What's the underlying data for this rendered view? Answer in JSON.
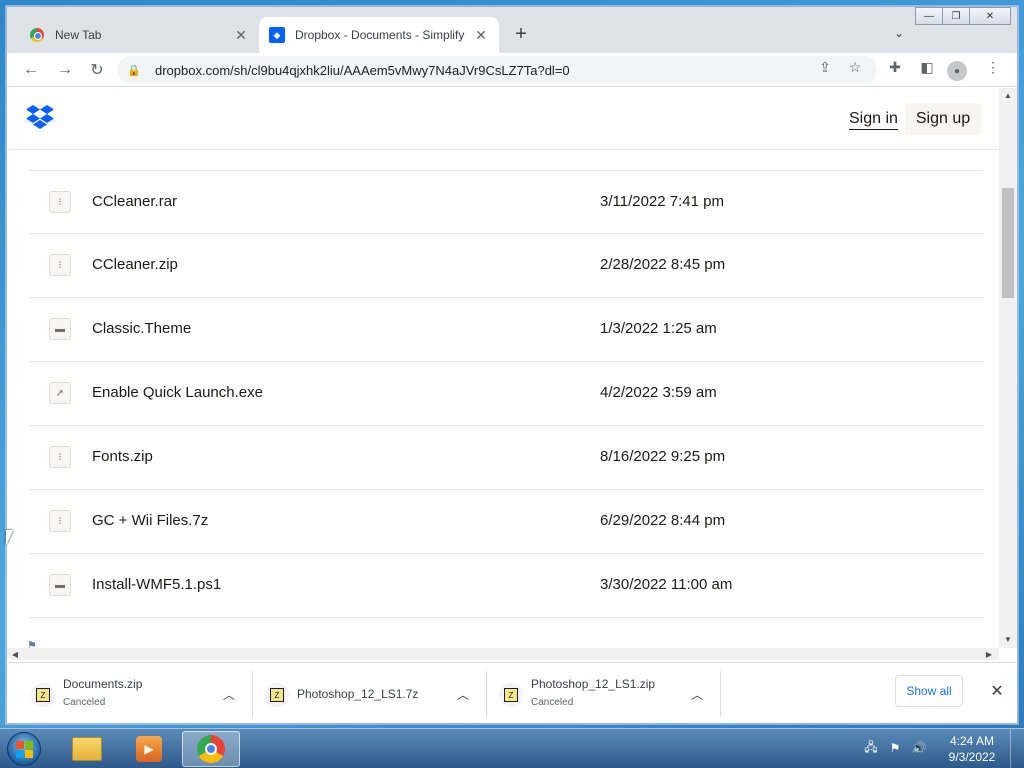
{
  "browser": {
    "tabs": [
      {
        "title": "New Tab",
        "favicon": "chrome-icon",
        "active": false
      },
      {
        "title": "Dropbox - Documents - Simplify",
        "favicon": "dropbox-icon",
        "active": true
      }
    ],
    "url": "dropbox.com/sh/cl9bu4qjxhk2liu/AAAem5vMwy7N4aJVr9CsLZ7Ta?dl=0",
    "window_controls": {
      "minimize": "—",
      "restore": "❐",
      "close": "✕"
    }
  },
  "header": {
    "signin_label": "Sign in",
    "signup_label": "Sign up"
  },
  "files": [
    {
      "name": "CCleaner.rar",
      "date": "3/11/2022 7:41 pm",
      "icon": "⁝"
    },
    {
      "name": "CCleaner.zip",
      "date": "2/28/2022 8:45 pm",
      "icon": "⁝"
    },
    {
      "name": "Classic.Theme",
      "date": "1/3/2022 1:25 am",
      "icon": "▬"
    },
    {
      "name": "Enable Quick Launch.exe",
      "date": "4/2/2022 3:59 am",
      "icon": "➚"
    },
    {
      "name": "Fonts.zip",
      "date": "8/16/2022 9:25 pm",
      "icon": "⁝"
    },
    {
      "name": "GC + Wii Files.7z",
      "date": "6/29/2022 8:44 pm",
      "icon": "⁝"
    },
    {
      "name": "Install-WMF5.1.ps1",
      "date": "3/30/2022 11:00 am",
      "icon": "▬"
    }
  ],
  "downloads": {
    "items": [
      {
        "name": "Documents.zip",
        "status": "Canceled"
      },
      {
        "name": "Photoshop_12_LS1.7z",
        "status": ""
      },
      {
        "name": "Photoshop_12_LS1.zip",
        "status": "Canceled"
      }
    ],
    "show_all_label": "Show all"
  },
  "taskbar": {
    "time": "4:24 AM",
    "date": "9/3/2022"
  },
  "colors": {
    "dropbox_blue": "#0061fe",
    "link_blue": "#1a73e8"
  }
}
